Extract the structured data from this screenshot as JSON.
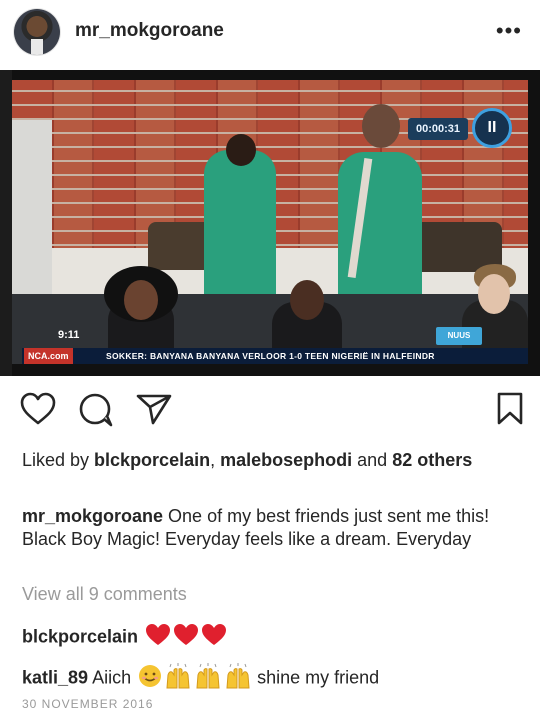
{
  "post": {
    "username": "mr_mokgoroane",
    "more_label": "•••",
    "photo": {
      "timer": "00:00:31",
      "pause_symbol": "II",
      "clock": "9:11",
      "channel_logo": "NCA.com",
      "news_badge": "NUUS",
      "ticker": "SOKKER: BANYANA BANYANA VERLOOR 1-0 TEEN NIGERIË IN HALFEINDR"
    },
    "likes": {
      "prefix": "Liked by ",
      "user1": "blckporcelain",
      "separator": ", ",
      "user2": "malebosephodi",
      "middle": " and ",
      "others": "82 others"
    },
    "caption": {
      "author": "mr_mokgoroane",
      "text": " One of my best friends just sent me this! Black Boy Magic! Everyday feels like a dream. Everyday"
    },
    "view_all_comments": "View all 9 comments",
    "comments": [
      {
        "user": "blckporcelain",
        "text": "",
        "emojis": [
          "heart",
          "heart",
          "heart"
        ]
      },
      {
        "user": "katli_89",
        "text_before": " Aiich",
        "text_after": " shine my friend",
        "emojis": [
          "smiling-face",
          "raising-hands",
          "raising-hands",
          "raising-hands"
        ]
      }
    ],
    "date": "30 NOVEMBER 2016"
  },
  "colors": {
    "text": "#262626",
    "muted": "#9a9a9a",
    "heart_red": "#e0202e",
    "clap_yellow": "#f5c431"
  }
}
